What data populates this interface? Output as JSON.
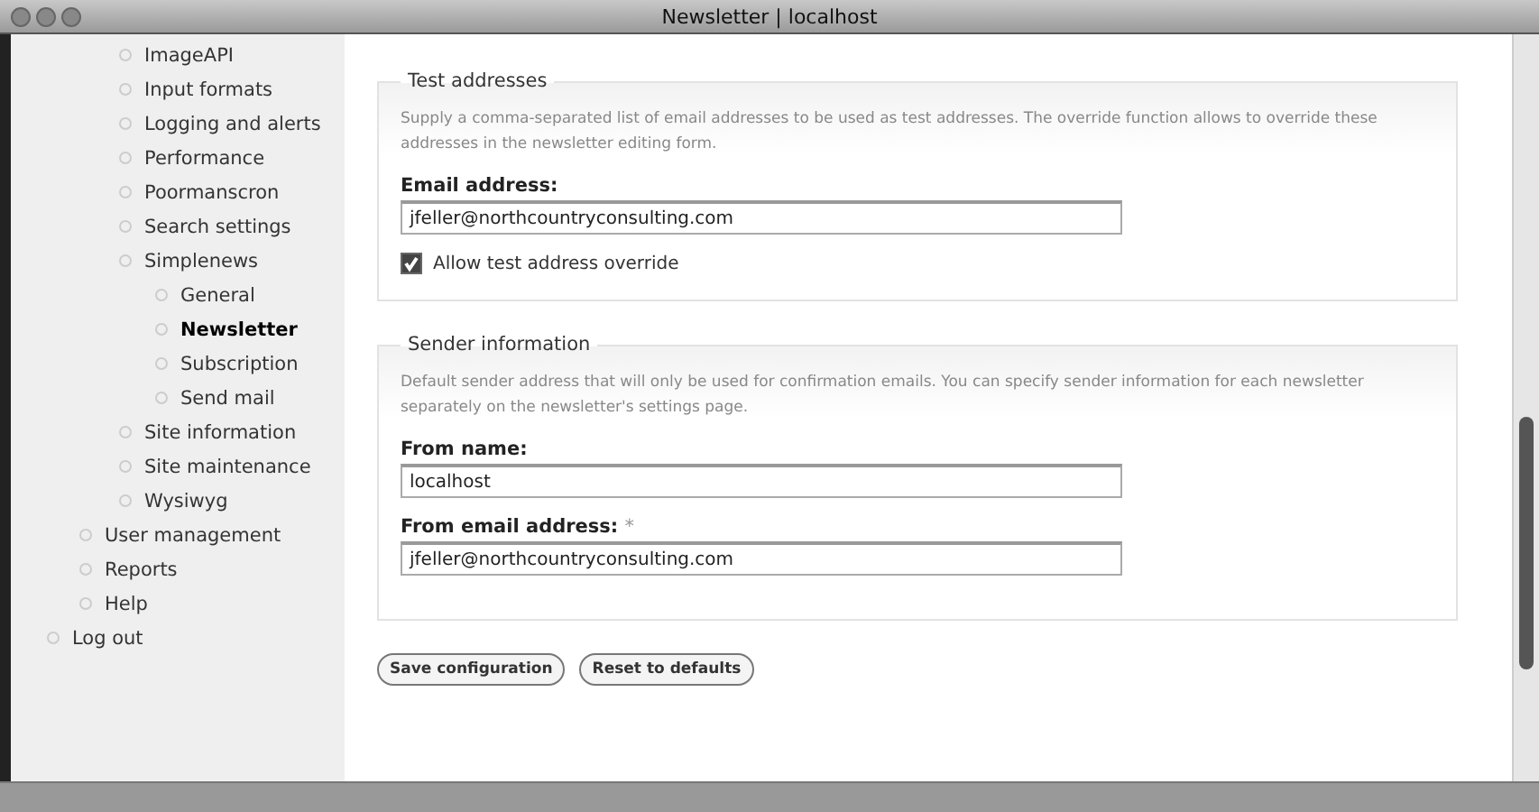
{
  "window": {
    "title": "Newsletter | localhost"
  },
  "sidebar": {
    "nested_items": [
      {
        "label": "ImageAPI",
        "selected": false
      },
      {
        "label": "Input formats",
        "selected": false
      },
      {
        "label": "Logging and alerts",
        "selected": false
      },
      {
        "label": "Performance",
        "selected": false
      },
      {
        "label": "Poormanscron",
        "selected": false
      },
      {
        "label": "Search settings",
        "selected": false
      },
      {
        "label": "Simplenews",
        "selected": false,
        "children": [
          {
            "label": "General",
            "selected": false
          },
          {
            "label": "Newsletter",
            "selected": true
          },
          {
            "label": "Subscription",
            "selected": false
          },
          {
            "label": "Send mail",
            "selected": false
          }
        ]
      },
      {
        "label": "Site information",
        "selected": false
      },
      {
        "label": "Site maintenance",
        "selected": false
      },
      {
        "label": "Wysiwyg",
        "selected": false
      }
    ],
    "items": [
      {
        "label": "User management",
        "selected": false
      },
      {
        "label": "Reports",
        "selected": false
      },
      {
        "label": "Help",
        "selected": false
      }
    ],
    "top_items": [
      {
        "label": "Log out",
        "selected": false
      }
    ]
  },
  "fieldsets": [
    {
      "legend": "Test addresses",
      "description": "Supply a comma-separated list of email addresses to be used as test addresses. The override function allows to override these addresses in the newsletter editing form.",
      "fields": [
        {
          "kind": "text",
          "label": "Email address:",
          "value": "jfeller@northcountryconsulting.com"
        },
        {
          "kind": "checkbox",
          "label": "Allow test address override",
          "checked": true
        }
      ]
    },
    {
      "legend": "Sender information",
      "description": "Default sender address that will only be used for confirmation emails. You can specify sender information for each newsletter separately on the newsletter's settings page.",
      "fields": [
        {
          "kind": "text",
          "label": "From name:",
          "value": "localhost"
        },
        {
          "kind": "text",
          "label": "From email address:",
          "required_mark": "*",
          "value": "jfeller@northcountryconsulting.com"
        }
      ]
    }
  ],
  "buttons": [
    "Save configuration",
    "Reset to defaults"
  ]
}
